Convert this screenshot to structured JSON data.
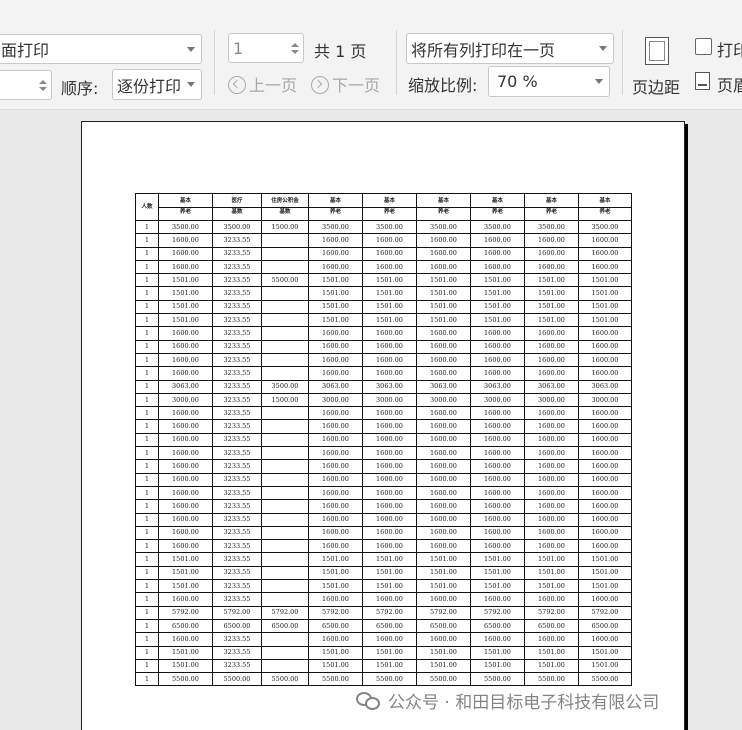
{
  "toolbar": {
    "print_mode": "面打印",
    "copies_value": "",
    "order_label": "顺序:",
    "order_value": "逐份打印",
    "page_value": "1",
    "total_pages": "共 1 页",
    "prev_page": "上一页",
    "next_page": "下一页",
    "scale_mode": "将所有列打印在一页",
    "zoom_label": "缩放比例:",
    "zoom_value": "70 %",
    "margin_label": "页边距",
    "print_check_label": "打印",
    "header_label": "页眉"
  },
  "sheet": {
    "headers": [
      {
        "l1": "人数",
        "l2": ""
      },
      {
        "l1": "基本",
        "l2": "养老"
      },
      {
        "l1": "医疗",
        "l2": "基数"
      },
      {
        "l1": "住房公积金",
        "l2": "基数"
      },
      {
        "l1": "基本",
        "l2": "养老"
      },
      {
        "l1": "基本",
        "l2": "养老"
      },
      {
        "l1": "基本",
        "l2": "养老"
      },
      {
        "l1": "基本",
        "l2": "养老"
      },
      {
        "l1": "基本",
        "l2": "养老"
      },
      {
        "l1": "基本",
        "l2": "养老"
      }
    ],
    "rows": [
      [
        "1",
        "3500.00",
        "3500.00",
        "1500.00",
        "3500.00",
        "3500.00",
        "3500.00",
        "3500.00",
        "3500.00",
        "3500.00"
      ],
      [
        "1",
        "1600.00",
        "3233.55",
        "",
        "1600.00",
        "1600.00",
        "1600.00",
        "1600.00",
        "1600.00",
        "1600.00"
      ],
      [
        "1",
        "1600.00",
        "3233.55",
        "",
        "1600.00",
        "1600.00",
        "1600.00",
        "1600.00",
        "1600.00",
        "1600.00"
      ],
      [
        "1",
        "1600.00",
        "3233.55",
        "",
        "1600.00",
        "1600.00",
        "1600.00",
        "1600.00",
        "1600.00",
        "1600.00"
      ],
      [
        "1",
        "1501.00",
        "3233.55",
        "5500.00",
        "1501.00",
        "1501.00",
        "1501.00",
        "1501.00",
        "1501.00",
        "1501.00"
      ],
      [
        "1",
        "1501.00",
        "3233.55",
        "",
        "1501.00",
        "1501.00",
        "1501.00",
        "1501.00",
        "1501.00",
        "1501.00"
      ],
      [
        "1",
        "1501.00",
        "3233.55",
        "",
        "1501.00",
        "1501.00",
        "1501.00",
        "1501.00",
        "1501.00",
        "1501.00"
      ],
      [
        "1",
        "1501.00",
        "3233.55",
        "",
        "1501.00",
        "1501.00",
        "1501.00",
        "1501.00",
        "1501.00",
        "1501.00"
      ],
      [
        "1",
        "1600.00",
        "3233.55",
        "",
        "1600.00",
        "1600.00",
        "1600.00",
        "1600.00",
        "1600.00",
        "1600.00"
      ],
      [
        "1",
        "1600.00",
        "3233.55",
        "",
        "1600.00",
        "1600.00",
        "1600.00",
        "1600.00",
        "1600.00",
        "1600.00"
      ],
      [
        "1",
        "1600.00",
        "3233.55",
        "",
        "1600.00",
        "1600.00",
        "1600.00",
        "1600.00",
        "1600.00",
        "1600.00"
      ],
      [
        "1",
        "1600.00",
        "3233.55",
        "",
        "1600.00",
        "1600.00",
        "1600.00",
        "1600.00",
        "1600.00",
        "1600.00"
      ],
      [
        "1",
        "3063.00",
        "3233.55",
        "3500.00",
        "3063.00",
        "3063.00",
        "3063.00",
        "3063.00",
        "3063.00",
        "3063.00"
      ],
      [
        "1",
        "3000.00",
        "3233.55",
        "1500.00",
        "3000.00",
        "3000.00",
        "3000.00",
        "3000.00",
        "3000.00",
        "3000.00"
      ],
      [
        "1",
        "1600.00",
        "3233.55",
        "",
        "1600.00",
        "1600.00",
        "1600.00",
        "1600.00",
        "1600.00",
        "1600.00"
      ],
      [
        "1",
        "1600.00",
        "3233.55",
        "",
        "1600.00",
        "1600.00",
        "1600.00",
        "1600.00",
        "1600.00",
        "1600.00"
      ],
      [
        "1",
        "1600.00",
        "3233.55",
        "",
        "1600.00",
        "1600.00",
        "1600.00",
        "1600.00",
        "1600.00",
        "1600.00"
      ],
      [
        "1",
        "1600.00",
        "3233.55",
        "",
        "1600.00",
        "1600.00",
        "1600.00",
        "1600.00",
        "1600.00",
        "1600.00"
      ],
      [
        "1",
        "1600.00",
        "3233.55",
        "",
        "1600.00",
        "1600.00",
        "1600.00",
        "1600.00",
        "1600.00",
        "1600.00"
      ],
      [
        "1",
        "1600.00",
        "3233.55",
        "",
        "1600.00",
        "1600.00",
        "1600.00",
        "1600.00",
        "1600.00",
        "1600.00"
      ],
      [
        "1",
        "1600.00",
        "3233.55",
        "",
        "1600.00",
        "1600.00",
        "1600.00",
        "1600.00",
        "1600.00",
        "1600.00"
      ],
      [
        "1",
        "1600.00",
        "3233.55",
        "",
        "1600.00",
        "1600.00",
        "1600.00",
        "1600.00",
        "1600.00",
        "1600.00"
      ],
      [
        "1",
        "1600.00",
        "3233.55",
        "",
        "1600.00",
        "1600.00",
        "1600.00",
        "1600.00",
        "1600.00",
        "1600.00"
      ],
      [
        "1",
        "1600.00",
        "3233.55",
        "",
        "1600.00",
        "1600.00",
        "1600.00",
        "1600.00",
        "1600.00",
        "1600.00"
      ],
      [
        "1",
        "1600.00",
        "3233.55",
        "",
        "1600.00",
        "1600.00",
        "1600.00",
        "1600.00",
        "1600.00",
        "1600.00"
      ],
      [
        "1",
        "1501.00",
        "3233.55",
        "",
        "1501.00",
        "1501.00",
        "1501.00",
        "1501.00",
        "1501.00",
        "1501.00"
      ],
      [
        "1",
        "1501.00",
        "3233.55",
        "",
        "1501.00",
        "1501.00",
        "1501.00",
        "1501.00",
        "1501.00",
        "1501.00"
      ],
      [
        "1",
        "1501.00",
        "3233.55",
        "",
        "1501.00",
        "1501.00",
        "1501.00",
        "1501.00",
        "1501.00",
        "1501.00"
      ],
      [
        "1",
        "1600.00",
        "3233.55",
        "",
        "1600.00",
        "1600.00",
        "1600.00",
        "1600.00",
        "1600.00",
        "1600.00"
      ],
      [
        "1",
        "5792.00",
        "5792.00",
        "5792.00",
        "5792.00",
        "5792.00",
        "5792.00",
        "5792.00",
        "5792.00",
        "5792.00"
      ],
      [
        "1",
        "6500.00",
        "6500.00",
        "6500.00",
        "6500.00",
        "6500.00",
        "6500.00",
        "6500.00",
        "6500.00",
        "6500.00"
      ],
      [
        "1",
        "1600.00",
        "3233.55",
        "",
        "1600.00",
        "1600.00",
        "1600.00",
        "1600.00",
        "1600.00",
        "1600.00"
      ],
      [
        "1",
        "1501.00",
        "3233.55",
        "",
        "1501.00",
        "1501.00",
        "1501.00",
        "1501.00",
        "1501.00",
        "1501.00"
      ],
      [
        "1",
        "1501.00",
        "3233.55",
        "",
        "1501.00",
        "1501.00",
        "1501.00",
        "1501.00",
        "1501.00",
        "1501.00"
      ],
      [
        "1",
        "5500.00",
        "5500.00",
        "5500.00",
        "5500.00",
        "5500.00",
        "5500.00",
        "5500.00",
        "5500.00",
        "5500.00"
      ]
    ]
  },
  "watermark": "公众号 · 和田目标电子科技有限公司"
}
